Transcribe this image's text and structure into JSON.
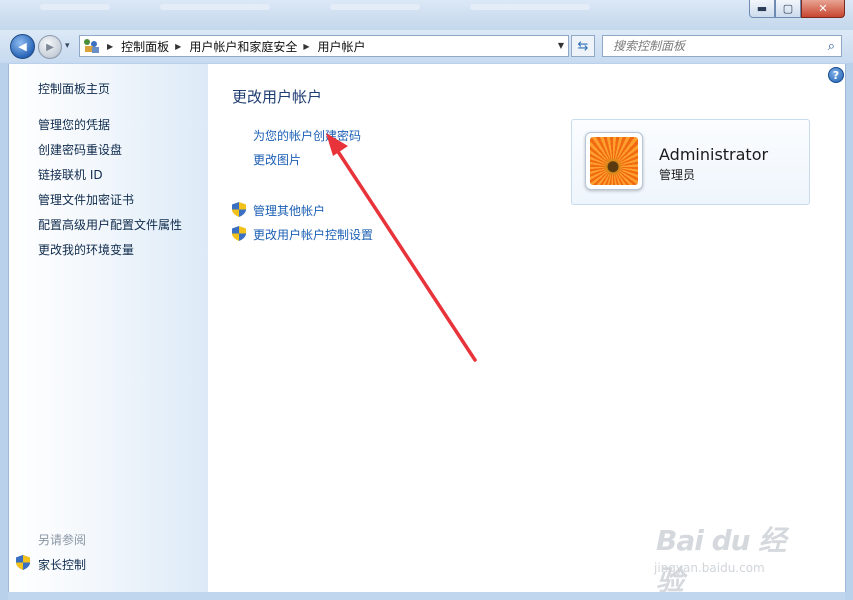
{
  "window": {
    "controls": {
      "minimize": "▬",
      "maximize": "▢",
      "close": "✕"
    }
  },
  "nav": {
    "back_glyph": "◀",
    "forward_glyph": "▶",
    "history_glyph": "▾",
    "breadcrumbs": [
      "控制面板",
      "用户帐户和家庭安全",
      "用户帐户"
    ],
    "separator": "▶",
    "address_dropdown": "▼",
    "refresh_glyph": "⇆",
    "search_placeholder": "搜索控制面板",
    "search_glyph": "⌕"
  },
  "sidebar": {
    "home_link": "控制面板主页",
    "items": [
      "管理您的凭据",
      "创建密码重设盘",
      "链接联机 ID",
      "管理文件加密证书",
      "配置高级用户配置文件属性",
      "更改我的环境变量"
    ],
    "see_also_title": "另请参阅",
    "see_also_items": [
      "家长控制"
    ]
  },
  "main": {
    "title": "更改用户帐户",
    "links": [
      "为您的帐户创建密码",
      "更改图片"
    ],
    "shield_links": [
      "管理其他帐户",
      "更改用户帐户控制设置"
    ],
    "help_glyph": "?"
  },
  "account": {
    "name": "Administrator",
    "role": "管理员"
  },
  "watermark": {
    "main": "Bai du 经验",
    "sub": "jingyan.baidu.com"
  },
  "colors": {
    "link": "#1c5fb5",
    "title": "#1e3d72",
    "arrow": "#e8333a"
  }
}
